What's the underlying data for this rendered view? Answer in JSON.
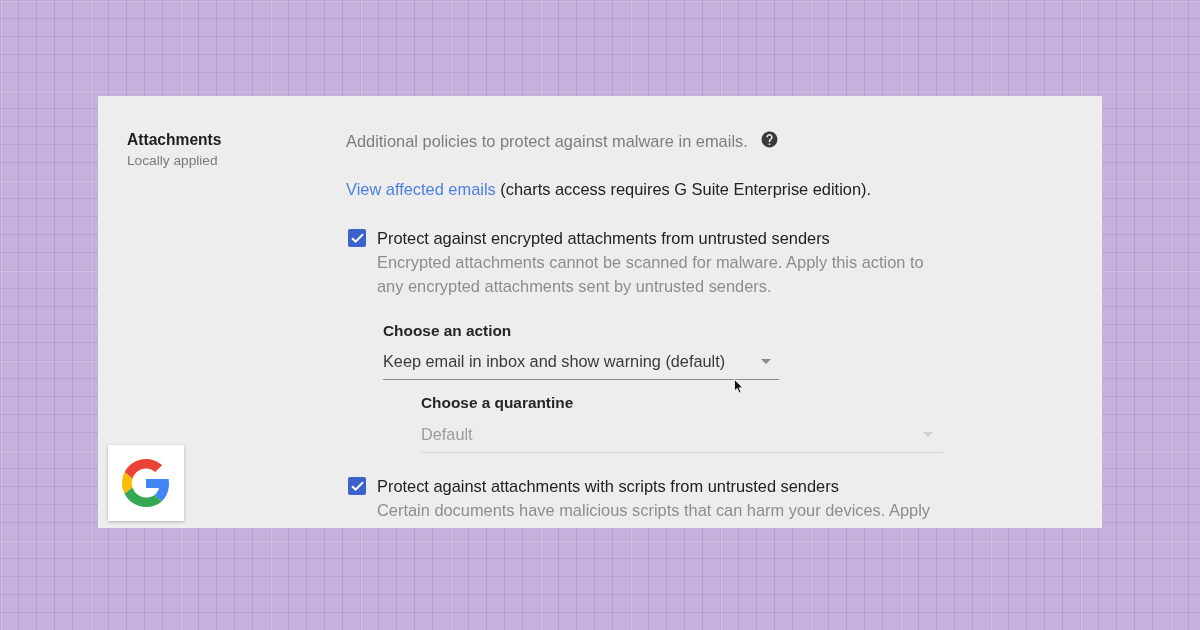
{
  "section": {
    "title": "Attachments",
    "subtitle": "Locally applied"
  },
  "intro": {
    "text": "Additional policies to protect against malware in emails."
  },
  "notice": {
    "link": "View affected emails",
    "text": "(charts access requires G Suite Enterprise edition)."
  },
  "policies": [
    {
      "label": "Protect against encrypted attachments from untrusted senders",
      "checked": true,
      "description": "Encrypted attachments cannot be scanned for malware. Apply this action to any encrypted attachments sent by untrusted senders.",
      "action": {
        "label": "Choose an action",
        "value": "Keep email in inbox and show warning (default)",
        "disabled": false,
        "quarantine": {
          "label": "Choose a quarantine",
          "value": "Default",
          "disabled": true
        }
      }
    },
    {
      "label": "Protect against attachments with scripts from untrusted senders",
      "checked": true,
      "description": "Certain documents have malicious scripts that can harm your devices. Apply"
    }
  ]
}
